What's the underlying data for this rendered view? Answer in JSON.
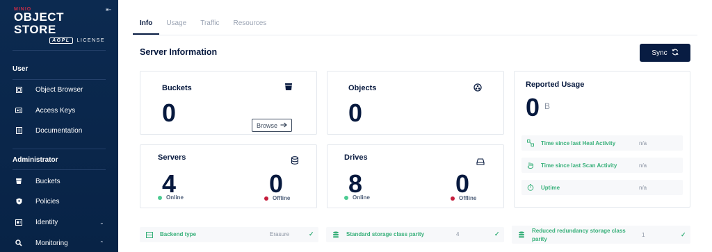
{
  "sidebar": {
    "brand": "MINIO",
    "product": "OBJECT STORE",
    "license_badge": "AGPL",
    "license_text": "LICENSE",
    "sections": {
      "user": "User",
      "administrator": "Administrator"
    },
    "user_items": [
      {
        "label": "Object Browser",
        "icon": "object-browser-icon"
      },
      {
        "label": "Access Keys",
        "icon": "access-keys-icon"
      },
      {
        "label": "Documentation",
        "icon": "documentation-icon"
      }
    ],
    "admin_items": [
      {
        "label": "Buckets",
        "icon": "buckets-icon"
      },
      {
        "label": "Policies",
        "icon": "policies-icon"
      },
      {
        "label": "Identity",
        "icon": "identity-icon",
        "chevron": "⌄"
      },
      {
        "label": "Monitoring",
        "icon": "monitoring-icon",
        "chevron": "⌃"
      }
    ]
  },
  "tabs": [
    {
      "label": "Info",
      "active": true
    },
    {
      "label": "Usage",
      "active": false
    },
    {
      "label": "Traffic",
      "active": false
    },
    {
      "label": "Resources",
      "active": false
    }
  ],
  "page": {
    "title": "Server Information",
    "sync_label": "Sync"
  },
  "cards": {
    "buckets": {
      "title": "Buckets",
      "value": "0",
      "browse_label": "Browse"
    },
    "objects": {
      "title": "Objects",
      "value": "0"
    },
    "servers": {
      "title": "Servers",
      "online_value": "4",
      "online_label": "Online",
      "offline_value": "0",
      "offline_label": "Offline"
    },
    "drives": {
      "title": "Drives",
      "online_value": "8",
      "online_label": "Online",
      "offline_value": "0",
      "offline_label": "Offline"
    },
    "usage": {
      "title": "Reported Usage",
      "value": "0",
      "unit": "B",
      "rows": [
        {
          "label": "Time since last Heal Activity",
          "value": "n/a",
          "icon": "heal-icon"
        },
        {
          "label": "Time since last Scan Activity",
          "value": "n/a",
          "icon": "scan-icon"
        },
        {
          "label": "Uptime",
          "value": "n/a",
          "icon": "uptime-icon"
        }
      ]
    }
  },
  "footer": {
    "backend_type_label": "Backend type",
    "backend_type_value": "Erasure",
    "standard_parity_label": "Standard storage class parity",
    "standard_parity_value": "4",
    "reduced_parity_label_line1": "Reduced redundancy storage class",
    "reduced_parity_label_line2": "parity",
    "reduced_parity_value": "1"
  },
  "colors": {
    "sidebar_bg": "#0c2a50",
    "primary": "#081c42",
    "online": "#4ccb92",
    "offline": "#c51d3c",
    "accent_green": "#38b07a"
  }
}
